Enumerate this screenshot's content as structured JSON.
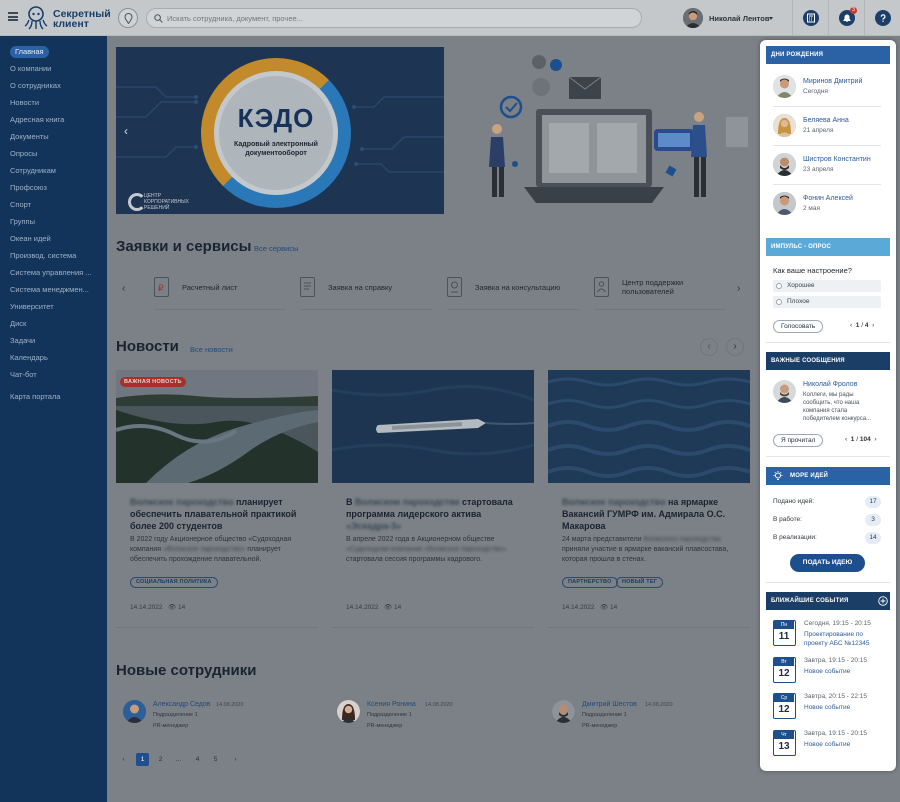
{
  "header": {
    "logo_line1": "Секретный",
    "logo_line2": "клиент",
    "search_placeholder": "Искать сотрудника, документ, прочее...",
    "user_name": "Николай Лентов",
    "notifications_count": "3",
    "icons": [
      "menu-icon",
      "location-pin-icon",
      "search-icon",
      "calculator-icon",
      "bell-icon",
      "help-icon"
    ]
  },
  "sidebar": {
    "items": [
      {
        "label": "Главная",
        "active": true
      },
      {
        "label": "О компании"
      },
      {
        "label": "О сотрудниках"
      },
      {
        "label": "Новости"
      },
      {
        "label": "Адресная книга"
      },
      {
        "label": "Документы"
      },
      {
        "label": "Опросы"
      },
      {
        "label": "Сотрудникам"
      },
      {
        "label": "Профсоюз"
      },
      {
        "label": "Спорт"
      },
      {
        "label": "Группы"
      },
      {
        "label": "Океан идей"
      },
      {
        "label": "Производ. система"
      },
      {
        "label": "Система управления ..."
      },
      {
        "label": "Система менеджмен..."
      },
      {
        "label": "Университет"
      },
      {
        "label": "Диск"
      },
      {
        "label": "Задачи"
      },
      {
        "label": "Календарь"
      },
      {
        "label": "Чат-бот"
      },
      {
        "label": "Карта портала"
      }
    ]
  },
  "banner": {
    "title": "КЭДО",
    "subtitle": "Кадровый электронный документооборот",
    "org_line1": "ЦЕНТР",
    "org_line2": "КОРПОРАТИВНЫХ",
    "org_line3": "РЕШЕНИЙ"
  },
  "services": {
    "title": "Заявки и сервисы",
    "all_link": "Все сервисы",
    "items": [
      {
        "label": "Расчетный лист",
        "icon": "payslip-icon"
      },
      {
        "label": "Заявка на справку",
        "icon": "certificate-icon"
      },
      {
        "label": "Заявка на консультацию",
        "icon": "consultation-icon"
      },
      {
        "label": "Центр поддержки пользователей",
        "icon": "support-icon"
      }
    ]
  },
  "news": {
    "title": "Новости",
    "all_link": "Все новости",
    "items": [
      {
        "tag": "ВАЖНАЯ НОВОСТЬ",
        "title_hidden": "Волжское пароходство",
        "title": "планирует обеспечить плавательной практикой более 200 студентов",
        "text_a": "В 2022 году Акционерное общество «Судоходная компания",
        "text_hidden": "«Волжское пароходство»",
        "text_b": "планирует обеспечить прохождение плавательной.",
        "chips": [
          "СОЦИАЛЬНАЯ ПОЛИТИКА"
        ],
        "date": "14.14.2022",
        "views": "14"
      },
      {
        "title_prefix": "В",
        "title_hidden": "Волжском пароходстве",
        "title": "стартовала программа лидерского актива",
        "title_hidden2": "«Эскадра-3»",
        "text_a": "В апреле 2022 года в Акционерном обществе",
        "text_hidden": "«Судоходная компания «Волжское пароходство»",
        "text_b": "стартовала сессия программы кадрового.",
        "chips": [],
        "date": "14.14.2022",
        "views": "14"
      },
      {
        "title_hidden": "Волжское пароходство",
        "title": "на ярмарке Вакансий ГУМРФ им. Адмирала О.С. Макарова",
        "text_a": "24 марта представители",
        "text_hidden": "Волжского пароходства",
        "text_b": "приняли участие в ярмарке вакансий плавсостава, которая прошла в стенах.",
        "chips": [
          "ПАРТНЕРСТВО",
          "НОВЫЙ ТЕГ"
        ],
        "date": "14.14.2022",
        "views": "14"
      }
    ]
  },
  "new_employees": {
    "title": "Новые сотрудники",
    "items": [
      {
        "name": "Александр Седов",
        "date": "14.08.2020",
        "dept": "Подразделение 1",
        "role": "PR-менеджер"
      },
      {
        "name": "Ксения Ронина",
        "date": "14.08.2020",
        "dept": "Подразделение 1",
        "role": "PR-менеджер"
      },
      {
        "name": "Дмитрий Шестов",
        "date": "14.08.2020",
        "dept": "Подразделение 1",
        "role": "PR-менеджер"
      }
    ],
    "pagination": [
      "1",
      "2",
      "...",
      "4",
      "5"
    ],
    "current_page": "1"
  },
  "right": {
    "birthdays": {
      "title": "ДНИ РОЖДЕНИЯ",
      "color": "#2a62a5",
      "items": [
        {
          "name": "Миринов Дмитрий",
          "date": "Сегодня"
        },
        {
          "name": "Беляева Анна",
          "date": "21 апреля"
        },
        {
          "name": "Шистров Константин",
          "date": "23 апреля"
        },
        {
          "name": "Фонин Алексей",
          "date": "2 мая"
        }
      ]
    },
    "poll": {
      "title": "ИМПУЛЬС - ОПРОС",
      "color": "#5aa9d6",
      "question": "Как ваше настроение?",
      "options": [
        "Хорошее",
        "Плохое"
      ],
      "button": "Голосовать",
      "current": "1",
      "total": "4"
    },
    "messages": {
      "title": "ВАЖНЫЕ СООБЩЕНИЯ",
      "color": "#1b3e66",
      "author": "Николай Фролов",
      "text": "Коллеги, мы рады сообщить, что наша компания стала победителем конкурса...",
      "button": "Я прочитал",
      "current": "1",
      "total": "104"
    },
    "ideas": {
      "title": "МОРЕ ИДЕЙ",
      "color": "#2a62a5",
      "rows": [
        {
          "label": "Подано идей:",
          "value": "17"
        },
        {
          "label": "В работе:",
          "value": "3"
        },
        {
          "label": "В реализации:",
          "value": "14"
        }
      ],
      "button": "ПОДАТЬ ИДЕЮ"
    },
    "events": {
      "title": "БЛИЖАЙШИЕ СОБЫТИЯ",
      "color": "#1b3e66",
      "items": [
        {
          "weekday": "Пн",
          "day": "11",
          "time": "Сегодня, 19:15 - 20:15",
          "name": "Проектирование по проекту АБС №12345"
        },
        {
          "weekday": "Вт",
          "day": "12",
          "time": "Завтра, 19:15 - 20:15",
          "name": "Новое событие"
        },
        {
          "weekday": "Ср",
          "day": "12",
          "time": "Завтра, 20:15 - 22:15",
          "name": "Новое событие"
        },
        {
          "weekday": "Чт",
          "day": "13",
          "time": "Завтра, 19:15 - 20:15",
          "name": "Новое событие"
        }
      ]
    }
  }
}
